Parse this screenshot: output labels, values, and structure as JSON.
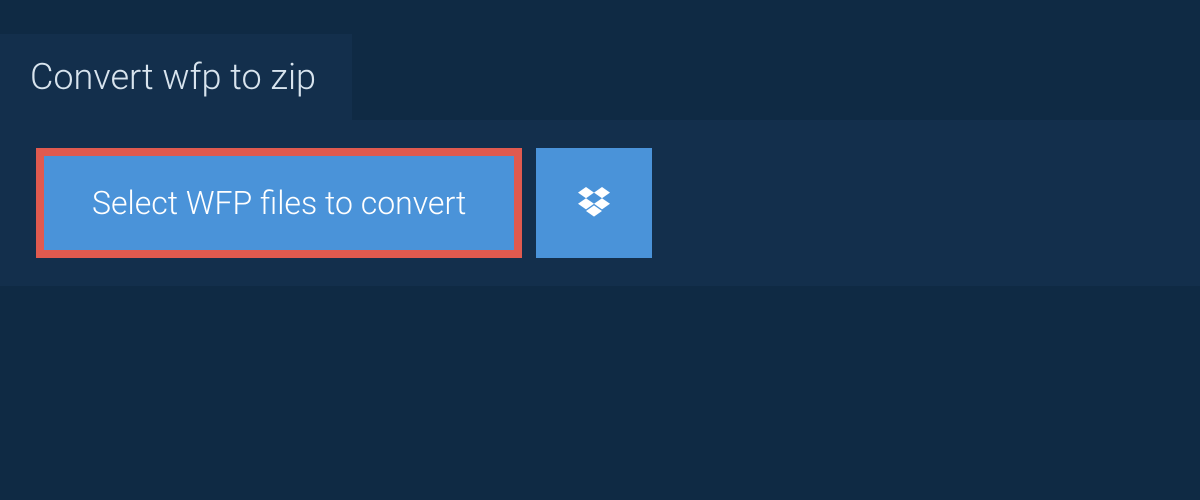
{
  "tab": {
    "label": "Convert wfp to zip"
  },
  "actions": {
    "select_label": "Select WFP files to convert"
  }
}
